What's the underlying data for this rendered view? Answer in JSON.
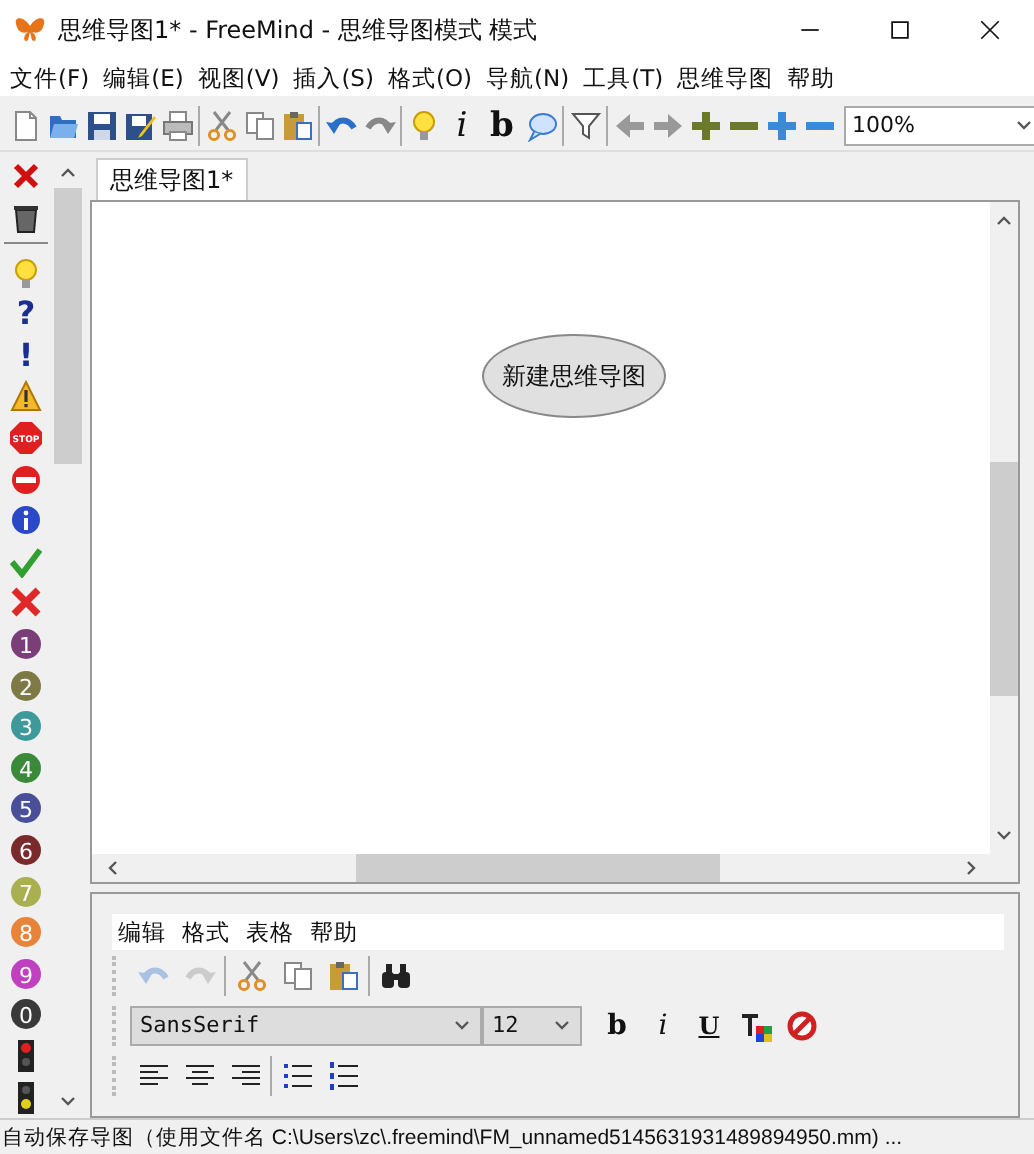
{
  "window": {
    "title": "思维导图1* - FreeMind - 思维导图模式 模式"
  },
  "menu": [
    "文件(F)",
    "编辑(E)",
    "视图(V)",
    "插入(S)",
    "格式(O)",
    "导航(N)",
    "工具(T)",
    "思维导图",
    "帮助"
  ],
  "toolbar": {
    "items": [
      {
        "kind": "document"
      },
      {
        "kind": "folder"
      },
      {
        "kind": "floppy"
      },
      {
        "kind": "floppy-pencil"
      },
      {
        "kind": "printer"
      },
      {
        "kind": "separator"
      },
      {
        "kind": "scissors"
      },
      {
        "kind": "copy"
      },
      {
        "kind": "clipboard"
      },
      {
        "kind": "separator"
      },
      {
        "kind": "undo"
      },
      {
        "kind": "redo"
      },
      {
        "kind": "separator"
      },
      {
        "kind": "bulb"
      },
      {
        "kind": "italic",
        "label": "i"
      },
      {
        "kind": "bold",
        "label": "b"
      },
      {
        "kind": "bubble"
      },
      {
        "kind": "separator"
      },
      {
        "kind": "filter"
      },
      {
        "kind": "separator"
      },
      {
        "kind": "arrow-left"
      },
      {
        "kind": "arrow-right"
      },
      {
        "kind": "plus",
        "color": "#6b7a2a"
      },
      {
        "kind": "minus",
        "color": "#6b7a2a"
      },
      {
        "kind": "plus",
        "color": "#3b8ad8"
      },
      {
        "kind": "minus",
        "color": "#3b8ad8"
      }
    ],
    "zoom": "100%"
  },
  "icon_palette": [
    {
      "kind": "close"
    },
    {
      "kind": "trash"
    },
    {
      "kind": "separator"
    },
    {
      "kind": "bulb"
    },
    {
      "kind": "glyph",
      "label": "?",
      "color": "#1c2f8f"
    },
    {
      "kind": "glyph",
      "label": "!",
      "color": "#1c2f8f"
    },
    {
      "kind": "warning"
    },
    {
      "kind": "stop",
      "label": "STOP"
    },
    {
      "kind": "no-entry"
    },
    {
      "kind": "info"
    },
    {
      "kind": "check"
    },
    {
      "kind": "cross"
    },
    {
      "kind": "number",
      "label": "1",
      "color": "#7a3f78"
    },
    {
      "kind": "number",
      "label": "2",
      "color": "#7d7a45"
    },
    {
      "kind": "number",
      "label": "3",
      "color": "#3e9a9a"
    },
    {
      "kind": "number",
      "label": "4",
      "color": "#3a8a3a"
    },
    {
      "kind": "number",
      "label": "5",
      "color": "#4a4f9a"
    },
    {
      "kind": "number",
      "label": "6",
      "color": "#7a2a2a"
    },
    {
      "kind": "number",
      "label": "7",
      "color": "#a8b050"
    },
    {
      "kind": "number",
      "label": "8",
      "color": "#e8843a"
    },
    {
      "kind": "number",
      "label": "9",
      "color": "#c040c0"
    },
    {
      "kind": "number",
      "label": "0",
      "color": "#3a3a3a"
    },
    {
      "kind": "traffic-red"
    },
    {
      "kind": "traffic-yellow"
    }
  ],
  "tabs": [
    {
      "label": "思维导图1*",
      "selected": true
    }
  ],
  "map": {
    "nodes": [
      {
        "text": "新建思维导图"
      }
    ]
  },
  "note_editor": {
    "menu": [
      "编辑",
      "格式",
      "表格",
      "帮助"
    ],
    "edit_buttons": [
      {
        "kind": "undo",
        "disabled": true
      },
      {
        "kind": "redo",
        "disabled": true
      },
      {
        "kind": "separator"
      },
      {
        "kind": "scissors",
        "disabled": false
      },
      {
        "kind": "copy",
        "disabled": false
      },
      {
        "kind": "clipboard",
        "disabled": false
      },
      {
        "kind": "separator"
      },
      {
        "kind": "binoculars",
        "disabled": false
      }
    ],
    "font": "SansSerif",
    "size": "12",
    "format_buttons": [
      {
        "kind": "bold",
        "label": "b"
      },
      {
        "kind": "italic",
        "label": "i"
      },
      {
        "kind": "underline",
        "label": "U"
      },
      {
        "kind": "text-color"
      },
      {
        "kind": "no-style"
      }
    ],
    "paragraph_buttons": [
      {
        "kind": "align-left"
      },
      {
        "kind": "align-center"
      },
      {
        "kind": "align-right"
      },
      {
        "kind": "separator"
      },
      {
        "kind": "bullet-list"
      },
      {
        "kind": "numbered-list"
      }
    ]
  },
  "status_bar": "自动保存导图（使用文件名 C:\\Users\\zc\\.freemind\\FM_unnamed5145631931489894950.mm) ..."
}
